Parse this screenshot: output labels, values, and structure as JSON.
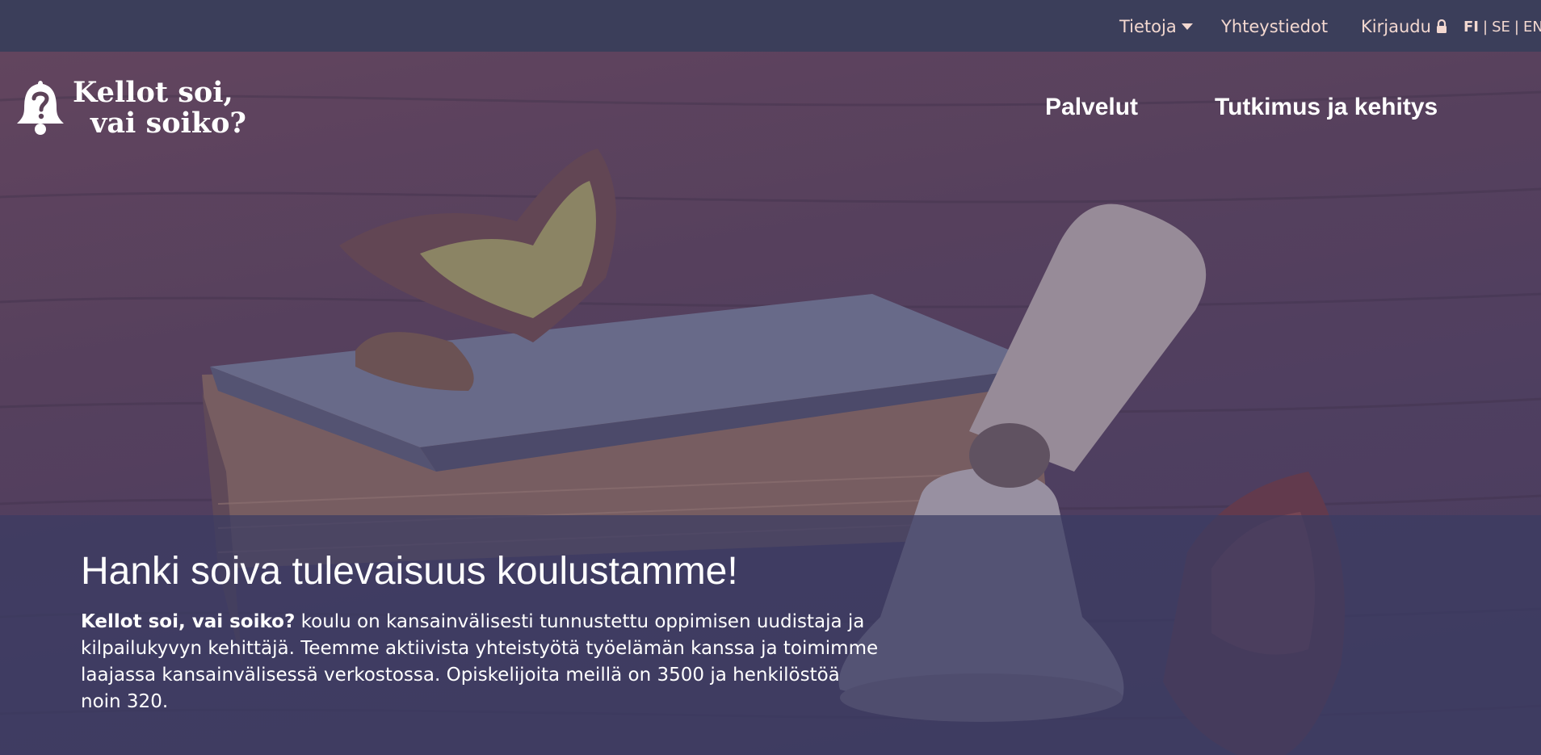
{
  "topbar": {
    "about_label": "Tietoja",
    "contact_label": "Yhteystiedot",
    "login_label": "Kirjaudu",
    "languages": [
      "FI",
      "SE",
      "EN"
    ],
    "active_language": "FI",
    "bg_color": "#3b3e5a",
    "text_color": "#f3d8d0"
  },
  "brand": {
    "name_line1": "Kellot soi,",
    "name_line2": "vai soiko?",
    "logo_icon": "bell-question-icon"
  },
  "mainnav": {
    "services_label": "Palvelut",
    "research_label": "Tutkimus ja kehitys"
  },
  "hero": {
    "headline": "Hanki soiva tulevaisuus koulustamme!",
    "body_bold": "Kellot soi, vai soiko?",
    "body_text": " koulu on kansainvälisesti tunnustettu oppimisen uudistaja ja kilpailukyvyn kehittäjä. Teemme aktiivista yhteistyötä työelämän kanssa ja toimimme laajassa kansainvälisessä verkostossa. Opiskelijoita meillä on 3500 ja henkilöstöä noin 320.",
    "image_subject": "old book with butterflies and a hand bell on a wooden table"
  }
}
